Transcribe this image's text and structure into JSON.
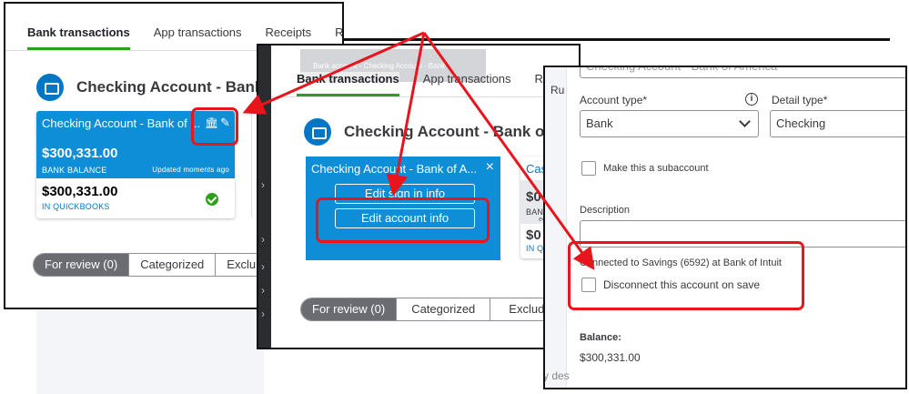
{
  "panel1": {
    "tabs": [
      "Bank transactions",
      "App transactions",
      "Receipts",
      "Rec"
    ],
    "account_title": "Checking Account - Bank o",
    "card": {
      "name": "Checking Account - Bank of ...",
      "bank_balance": "$300,331.00",
      "bank_balance_label": "BANK BALANCE",
      "updated": "Updated moments ago",
      "qb_balance": "$300,331.00",
      "qb_label": "IN QUICKBOOKS"
    },
    "review_tabs": [
      "For review (0)",
      "Categorized",
      "Exclu"
    ]
  },
  "panel2": {
    "faint_tab": "Bank account - Checking Account - Bank",
    "tabs": [
      "Bank transactions",
      "App transactions",
      "Rece"
    ],
    "account_title": "Checking Account - Bank of A",
    "card": {
      "name": "Checking Account - Bank of A...",
      "close": "×",
      "edit_sign_in": "Edit sign in info",
      "edit_account": "Edit account info"
    },
    "side_card": {
      "name": "Cas",
      "amt1": "$0",
      "cap1": "BAN",
      "note": "ed o",
      "amt2": "$0",
      "cap2": "IN Q"
    },
    "review_tabs": [
      "For review (0)",
      "Categorized",
      "Exclude"
    ]
  },
  "panel3": {
    "name_value": "Checking Account - Bank of America",
    "right_clip": "Ru",
    "account_type_label": "Account type*",
    "detail_type_label": "Detail type*",
    "info_icon": "i",
    "account_type_value": "Bank",
    "detail_type_value": "Checking",
    "subaccount_label": "Make this a subaccount",
    "description_label": "Description",
    "connected_text": "Connected to Savings (6592) at Bank of Intuit",
    "disconnect_label": "Disconnect this account on save",
    "balance_label": "Balance:",
    "balance_value": "$300,331.00",
    "bottom_clip": "y des"
  },
  "colors": {
    "brand_blue": "#0077c5",
    "card_blue": "#0d8ed7",
    "highlight_red": "#e8161c",
    "accent_green": "#2ca01c"
  }
}
